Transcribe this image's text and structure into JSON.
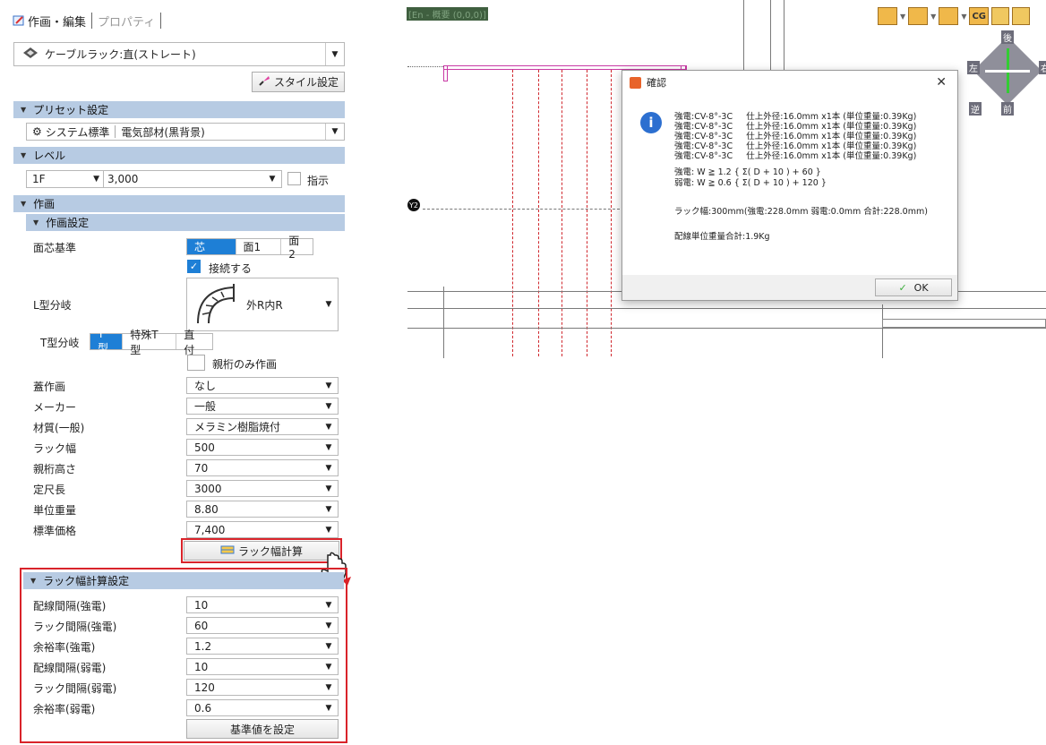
{
  "tabs": {
    "edit": "作画・編集",
    "properties": "プロパティ"
  },
  "style_combo": {
    "value": "ケーブルラック:直(ストレート)"
  },
  "style_button": "スタイル設定",
  "sections": {
    "preset": "プリセット設定",
    "level": "レベル",
    "drawing": "作画",
    "drawing_settings": "作画設定",
    "rack_calc": "ラック幅計算設定"
  },
  "preset": {
    "value1": "システム標準",
    "value2": "電気部材(黒背景)"
  },
  "level": {
    "floor": "1F",
    "height": "3,000",
    "indicate": "指示"
  },
  "drawing": {
    "face_basis_label": "面芯基準",
    "face_basis_options": [
      "芯",
      "面1",
      "面2"
    ],
    "connect_label": "接続する",
    "l_branch_label": "L型分岐",
    "l_branch_value": "外R内R",
    "t_branch_label": "T型分岐",
    "t_branch_options": [
      "T型",
      "特殊T型",
      "直付"
    ],
    "parent_only_label": "親桁のみ作画",
    "fields": [
      {
        "label": "蓋作画",
        "value": "なし"
      },
      {
        "label": "メーカー",
        "value": "一般"
      },
      {
        "label": "材質(一般)",
        "value": "メラミン樹脂焼付"
      },
      {
        "label": "ラック幅",
        "value": "500"
      },
      {
        "label": "親桁高さ",
        "value": "70"
      },
      {
        "label": "定尺長",
        "value": "3000"
      },
      {
        "label": "単位重量",
        "value": "8.80"
      },
      {
        "label": "標準価格",
        "value": "7,400"
      }
    ],
    "rack_calc_button": "ラック幅計算"
  },
  "rack_calc": {
    "fields": [
      {
        "label": "配線間隔(強電)",
        "value": "10"
      },
      {
        "label": "ラック間隔(強電)",
        "value": "60"
      },
      {
        "label": "余裕率(強電)",
        "value": "1.2"
      },
      {
        "label": "配線間隔(弱電)",
        "value": "10"
      },
      {
        "label": "ラック間隔(弱電)",
        "value": "120"
      },
      {
        "label": "余裕率(弱電)",
        "value": "0.6"
      }
    ],
    "set_default_button": "基準値を設定"
  },
  "cad": {
    "coord_text": "[En - 概要 (0,0,0)]",
    "grid_label": "Y2",
    "toolbar_cg": "CG",
    "view_cube": {
      "top": "後",
      "left": "左",
      "bottom_left": "逆",
      "bottom": "前",
      "right": "右"
    }
  },
  "dialog": {
    "title": "確認",
    "lines": [
      "強電:CV-8°-3C     仕上外径:16.0mm x1本 (単位重量:0.39Kg)",
      "強電:CV-8°-3C     仕上外径:16.0mm x1本 (単位重量:0.39Kg)",
      "強電:CV-8°-3C     仕上外径:16.0mm x1本 (単位重量:0.39Kg)",
      "強電:CV-8°-3C     仕上外径:16.0mm x1本 (単位重量:0.39Kg)",
      "強電:CV-8°-3C     仕上外径:16.0mm x1本 (単位重量:0.39Kg)"
    ],
    "formula_strong": "強電: W ≧ 1.2 { Σ( D + 10 ) + 60 }",
    "formula_weak": "弱電: W ≧ 0.6 { Σ( D + 10 ) + 120 }",
    "rack_width": "ラック幅:300mm(強電:228.0mm 弱電:0.0mm 合計:228.0mm)",
    "total_weight": "配線単位重量合計:1.9Kg",
    "ok": "OK"
  },
  "colors": {
    "accent": "#1e7fd6",
    "section": "#b7cbe3",
    "highlight": "#d9232a"
  }
}
